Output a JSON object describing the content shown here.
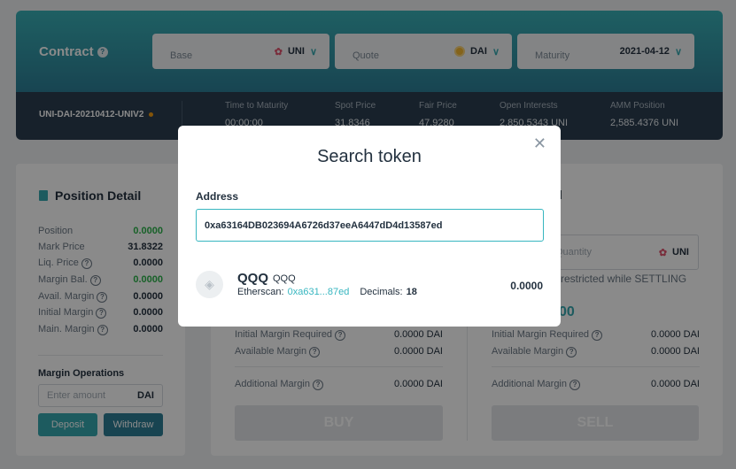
{
  "header": {
    "contract_label": "Contract",
    "base": {
      "label": "Base",
      "value": "UNI"
    },
    "quote": {
      "label": "Quote",
      "value": "DAI"
    },
    "maturity": {
      "label": "Maturity",
      "value": "2021-04-12"
    },
    "pair_name": "UNI-DAI-20210412-UNIV2",
    "stats": [
      {
        "label": "Time to Maturity",
        "value": "00:00:00"
      },
      {
        "label": "Spot Price",
        "value": "31.8346"
      },
      {
        "label": "Fair Price",
        "value": "47.9280"
      },
      {
        "label": "Open Interests",
        "value": "2,850.5343 UNI"
      },
      {
        "label": "AMM Position",
        "value": "2,585.4376 UNI"
      }
    ]
  },
  "position_detail": {
    "title": "Position Detail",
    "rows": [
      {
        "label": "Position",
        "value": "0.0000",
        "green": true
      },
      {
        "label": "Mark Price",
        "value": "31.8322",
        "green": false
      },
      {
        "label": "Liq. Price",
        "value": "0.0000",
        "green": false
      },
      {
        "label": "Margin Bal.",
        "value": "0.0000",
        "green": true
      },
      {
        "label": "Avail. Margin",
        "value": "0.0000",
        "green": false
      },
      {
        "label": "Initial Margin",
        "value": "0.0000",
        "green": false
      },
      {
        "label": "Main. Margin",
        "value": "0.0000",
        "green": false
      }
    ],
    "margin_ops_title": "Margin Operations",
    "amount_placeholder": "Enter amount",
    "amount_unit": "DAI",
    "deposit_label": "Deposit",
    "withdraw_label": "Withdraw"
  },
  "trade": {
    "buy": {
      "initial_margin_label": "Initial Margin Required",
      "initial_margin_value": "0.0000 DAI",
      "available_margin_label": "Available Margin",
      "available_margin_value": "0.0000 DAI",
      "additional_margin_label": "Additional Margin",
      "additional_margin_value": "0.0000 DAI",
      "button": "BUY"
    },
    "sell": {
      "initial_margin_label": "Initial Margin Required",
      "initial_margin_value": "0.0000 DAI",
      "available_margin_label": "Available Margin",
      "available_margin_value": "0.0000 DAI",
      "additional_margin_label": "Additional Margin",
      "additional_margin_value": "0.0000 DAI",
      "button": "SELL"
    },
    "sell_title_fragment": "l",
    "quantity_placeholder": "Quantity",
    "quantity_unit": "UNI",
    "restricted_text": "restricted while SETTLING",
    "price_fragment": "00"
  },
  "modal": {
    "title": "Search token",
    "address_label": "Address",
    "address_value": "0xa63164DB023694A6726d37eeA6447dD4d13587ed",
    "token": {
      "symbol": "QQQ",
      "name": "QQQ",
      "etherscan_label": "Etherscan:",
      "etherscan_link": "0xa631...87ed",
      "decimals_label": "Decimals:",
      "decimals_value": "18",
      "balance": "0.0000"
    }
  }
}
